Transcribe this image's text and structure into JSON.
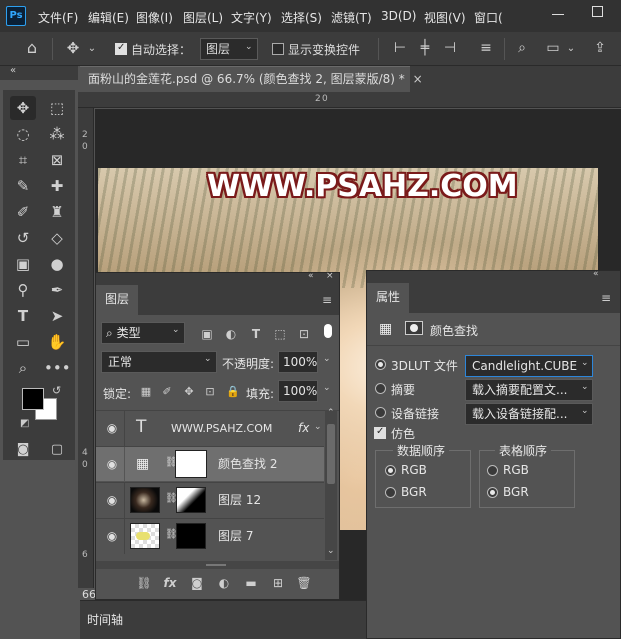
{
  "app": {
    "logo": "Ps"
  },
  "menu": [
    "文件(F)",
    "编辑(E)",
    "图像(I)",
    "图层(L)",
    "文字(Y)",
    "选择(S)",
    "滤镜(T)",
    "3D(D)",
    "视图(V)",
    "窗口("
  ],
  "options_bar": {
    "auto_select_label": "自动选择：",
    "auto_select_checked": true,
    "auto_select_target": "图层",
    "show_transform_label": "显示变换控件",
    "show_transform_checked": false
  },
  "document": {
    "tab_title": "面粉山的金莲花.psd @ 66.7% (颜色查找 2, 图层蒙版/8) *",
    "ruler_top": [
      "2",
      "0"
    ],
    "ruler_left": [
      "2",
      "0",
      "4",
      "0",
      "6"
    ],
    "zoom_status": "66",
    "watermark": "WWW.PSAHZ.COM"
  },
  "layers_panel": {
    "tab": "图层",
    "filter_kind": "类型",
    "blend_mode": "正常",
    "opacity_label": "不透明度:",
    "opacity_value": "100%",
    "lock_label": "锁定:",
    "fill_label": "填充:",
    "fill_value": "100%",
    "layers": [
      {
        "name": "WWW.PSAHZ.COM",
        "kind": "text",
        "fx": "fx",
        "visible": true,
        "selected": false
      },
      {
        "name": "颜色查找 2",
        "kind": "adjustment",
        "visible": true,
        "selected": true
      },
      {
        "name": "图层 12",
        "kind": "pixel-masked",
        "visible": true,
        "selected": false
      },
      {
        "name": "图层 7",
        "kind": "pixel-masked",
        "visible": true,
        "selected": false
      }
    ]
  },
  "properties_panel": {
    "tab": "属性",
    "header_label": "颜色查找",
    "lut_3d_label": "3DLUT 文件",
    "lut_3d_value": "Candlelight.CUBE",
    "abstract_label": "摘要",
    "abstract_value": "载入摘要配置文...",
    "device_link_label": "设备链接",
    "device_link_value": "载入设备链接配...",
    "dither_label": "仿色",
    "dither_checked": true,
    "data_order": {
      "title": "数据顺序",
      "options": [
        "RGB",
        "BGR"
      ],
      "selected": "RGB"
    },
    "table_order": {
      "title": "表格顺序",
      "options": [
        "RGB",
        "BGR"
      ],
      "selected": "BGR"
    }
  },
  "timeline": {
    "label": "时间轴"
  }
}
